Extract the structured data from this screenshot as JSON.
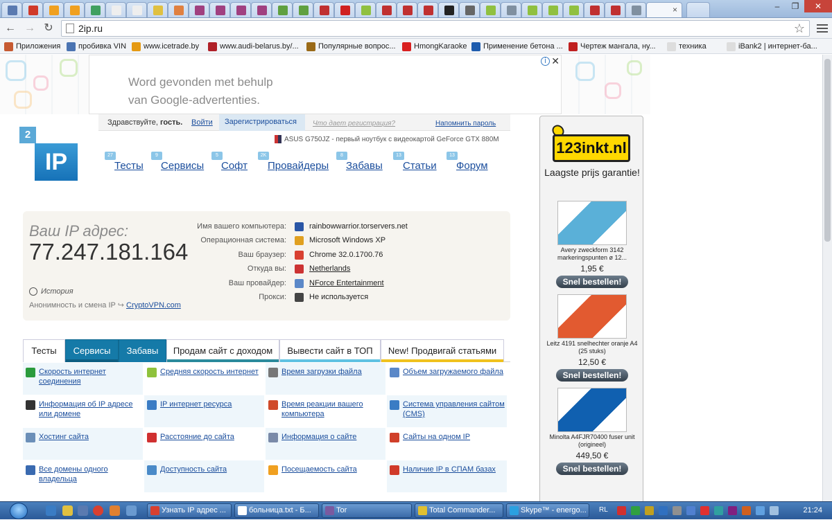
{
  "browser": {
    "active_tab_title": "×",
    "address": "2ip.ru",
    "bookmarks": [
      {
        "label": "Приложения",
        "color": "#c65a32"
      },
      {
        "label": "пробивка VIN",
        "color": "#4b74b2"
      },
      {
        "label": "www.icetrade.by",
        "color": "#e59a14"
      },
      {
        "label": "www.audi-belarus.by/...",
        "color": "#b02028"
      },
      {
        "label": "Популярные вопрос...",
        "color": "#9a6a18"
      },
      {
        "label": "HmongKaraoke",
        "color": "#d92020"
      },
      {
        "label": "Применение бетона ...",
        "color": "#1e5cae"
      },
      {
        "label": "Чертеж мангала, ну...",
        "color": "#c02020"
      },
      {
        "label": "техника",
        "color": "#dddddd"
      },
      {
        "label": "iBank2 | интернет-ба...",
        "color": "#dddddd"
      }
    ]
  },
  "ad_top": {
    "line1": "Word gevonden met behulp",
    "line2": "van Google-advertenties."
  },
  "login": {
    "greeting": "Здравствуйте,",
    "guest": "гость.",
    "enter": "Войти",
    "register": "Зарегистрироваться",
    "why": "Что дает регистрация?",
    "remind": "Напомнить пароль"
  },
  "logo": {
    "badge": "2",
    "text": "IP"
  },
  "promo": "ASUS G750JZ - первый ноутбук с видеокартой GeForce GTX 880M",
  "nav": [
    {
      "label": "Тесты",
      "badge": "27"
    },
    {
      "label": "Сервисы",
      "badge": "9"
    },
    {
      "label": "Софт",
      "badge": "5"
    },
    {
      "label": "Провайдеры",
      "badge": "2K"
    },
    {
      "label": "Забавы",
      "badge": "8"
    },
    {
      "label": "Статьи",
      "badge": "13"
    },
    {
      "label": "Форум",
      "badge": "13"
    }
  ],
  "ipinfo": {
    "label": "Ваш IP адрес:",
    "ip": "77.247.181.164",
    "history": "История",
    "anon_prefix": "Анонимность и смена IP",
    "anon_link": "CryptoVPN.com",
    "rows": [
      {
        "key": "Имя вашего компьютера:",
        "value": "rainbowwarrior.torservers.net",
        "link": false,
        "color": "#2a56a6"
      },
      {
        "key": "Операционная система:",
        "value": "Microsoft Windows XP",
        "link": false,
        "color": "#e0a020"
      },
      {
        "key": "Ваш браузер:",
        "value": "Chrome 32.0.1700.76",
        "link": false,
        "color": "#d84030"
      },
      {
        "key": "Откуда вы:",
        "value": "Netherlands",
        "link": true,
        "color": "#cc3333"
      },
      {
        "key": "Ваш провайдер:",
        "value": "NForce Entertainment",
        "link": true,
        "color": "#5b88c8"
      },
      {
        "key": "Прокси:",
        "value": "Не используется",
        "link": false,
        "color": "#444444"
      }
    ]
  },
  "section_tabs": [
    {
      "label": "Тесты",
      "dark": false,
      "strip": ""
    },
    {
      "label": "Сервисы",
      "dark": true,
      "strip": "#0d5e82"
    },
    {
      "label": "Забавы",
      "dark": true,
      "strip": ""
    },
    {
      "label": "Продам сайт с доходом",
      "dark": false,
      "strip": "#2a8a9c"
    },
    {
      "label": "Вывести сайт в ТОП",
      "dark": false,
      "strip": "#5fc2e2"
    },
    {
      "label": "New! Продвигай статьями",
      "dark": false,
      "strip": "#f0c21e"
    }
  ],
  "services": [
    {
      "label": "Скорость интернет соединения",
      "color": "#2b9b3c"
    },
    {
      "label": "Средняя скорость интернет",
      "color": "#8fc23c"
    },
    {
      "label": "Время загрузки файла",
      "color": "#777777"
    },
    {
      "label": "Объем загружаемого файла",
      "color": "#5b88c8"
    },
    {
      "label": "Информация об IP адресе или домене",
      "color": "#333333"
    },
    {
      "label": "IP интернет ресурса",
      "color": "#3a7cc4"
    },
    {
      "label": "Время реакции вашего компьютера",
      "color": "#d04a2a"
    },
    {
      "label": "Система управления сайтом (CMS)",
      "color": "#3a7cc4"
    },
    {
      "label": "Хостинг сайта",
      "color": "#6b8fb8"
    },
    {
      "label": "Расстояние до сайта",
      "color": "#d03030"
    },
    {
      "label": "Информация о сайте",
      "color": "#7a8aa8"
    },
    {
      "label": "Сайты на одном IP",
      "color": "#d0402a"
    },
    {
      "label": "Все домены одного владельца",
      "color": "#3a6ab0"
    },
    {
      "label": "Доступность сайта",
      "color": "#4a8ac8"
    },
    {
      "label": "Посещаемость сайта",
      "color": "#f0a020"
    },
    {
      "label": "Наличие IP в СПАМ базах",
      "color": "#d03a2a"
    }
  ],
  "right_ad": {
    "brand": "123inkt.nl",
    "slogan": "Laagste prijs garantie!",
    "products": [
      {
        "name": "Avery zweckform 3142 markeringspunten ø 12...",
        "price": "1,95 €",
        "buy": "Snel bestellen!"
      },
      {
        "name": "Leitz 4191 snelhechter oranje A4 (25 stuks)",
        "price": "12,50 €",
        "buy": "Snel bestellen!"
      },
      {
        "name": "Minolta A4FJR70400 fuser unit (origineel)",
        "price": "449,50 €",
        "buy": "Snel bestellen!"
      }
    ]
  },
  "taskbar": {
    "windows": [
      {
        "label": "Узнать IP адрес ...",
        "color": "#d84030"
      },
      {
        "label": "больница.txt - Б...",
        "color": "#ffffff"
      },
      {
        "label": "Tor",
        "color": "#7a5aa0"
      },
      {
        "label": "Total Commander...",
        "color": "#e0c030"
      },
      {
        "label": "Skype™ - energo...",
        "color": "#2aa0e0"
      }
    ],
    "lang": "RL",
    "clock": "21:24"
  }
}
